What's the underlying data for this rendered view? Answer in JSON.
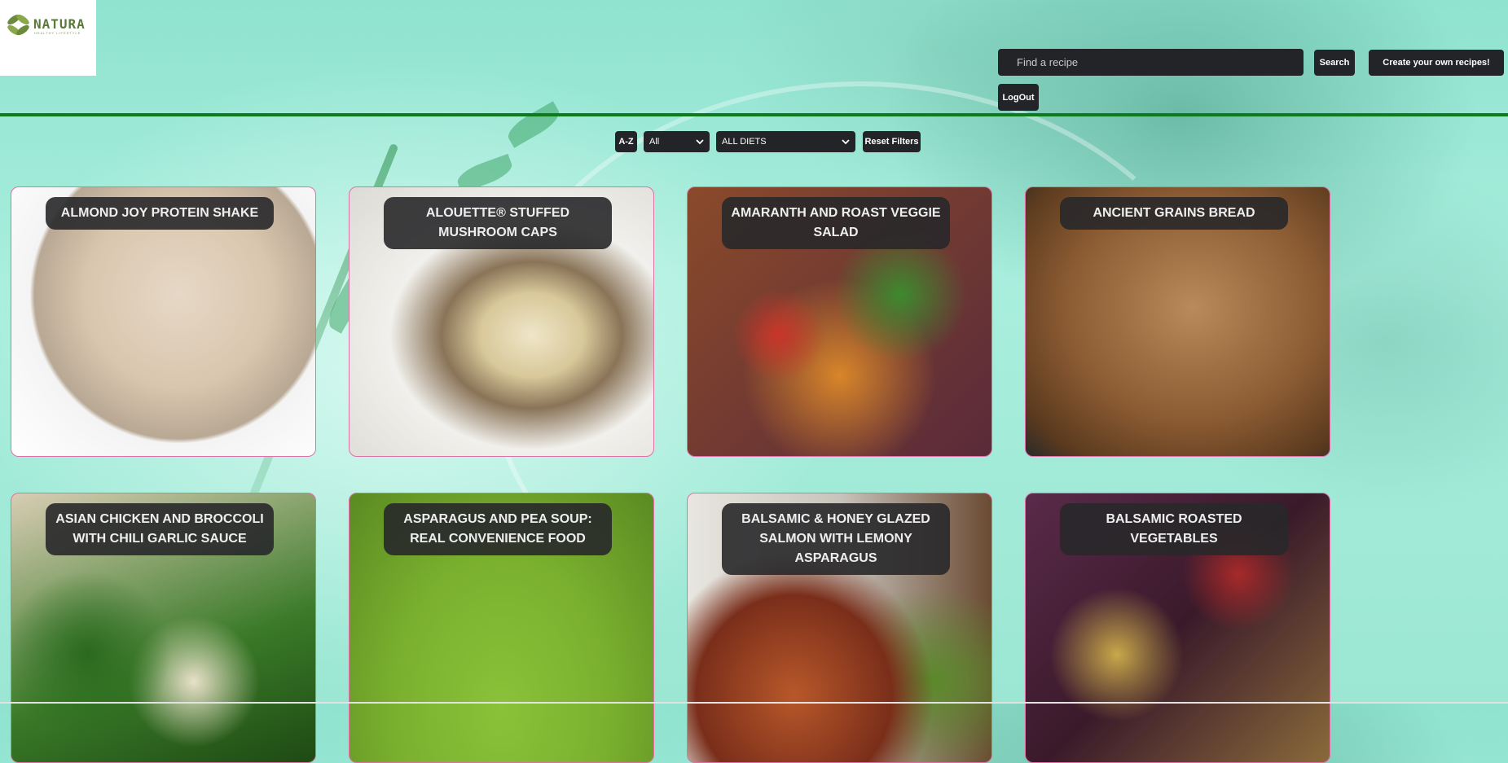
{
  "brand": {
    "name": "NATURA",
    "tagline": "HEALTHY LIFESTYLE"
  },
  "header": {
    "search_placeholder": "Find a recipe",
    "search_button": "Search",
    "create_button": "Create your own recipes!",
    "logout_button": "LogOut"
  },
  "filters": {
    "sort_button": "A-Z",
    "category_select": "All",
    "diet_select": "ALL DIETS",
    "reset_button": "Reset Filters"
  },
  "recipes": [
    {
      "title": "ALMOND JOY PROTEIN SHAKE"
    },
    {
      "title": "ALOUETTE® STUFFED MUSHROOM CAPS"
    },
    {
      "title": "AMARANTH AND ROAST VEGGIE SALAD"
    },
    {
      "title": "ANCIENT GRAINS BREAD"
    },
    {
      "title": "ASIAN CHICKEN AND BROCCOLI WITH CHILI GARLIC SAUCE"
    },
    {
      "title": "ASPARAGUS AND PEA SOUP: REAL CONVENIENCE FOOD"
    },
    {
      "title": "BALSAMIC & HONEY GLAZED SALMON WITH LEMONY ASPARAGUS"
    },
    {
      "title": "BALSAMIC ROASTED VEGETABLES"
    }
  ],
  "colors": {
    "accent_line": "#0e7a1c",
    "card_border": "#e070a8",
    "button_bg": "#222428"
  }
}
